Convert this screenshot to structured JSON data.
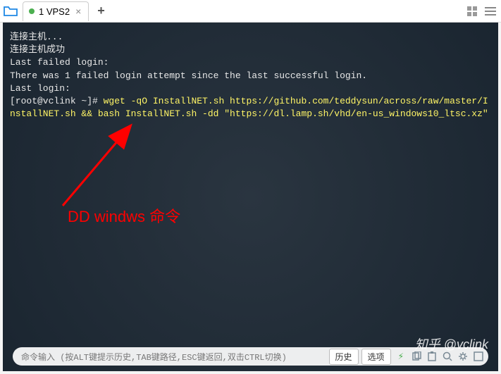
{
  "tabs": {
    "active": {
      "label": "1 VPS2"
    }
  },
  "terminal": {
    "l1": "连接主机...",
    "l2": "连接主机成功",
    "l3": "Last failed login:",
    "l4": "There was 1 failed login attempt since the last successful login.",
    "l5": "Last login:",
    "prompt": "[root@vclink ~]# ",
    "cmd": "wget -qO InstallNET.sh https://github.com/teddysun/across/raw/master/InstallNET.sh && bash InstallNET.sh -dd \"https://dl.lamp.sh/vhd/en-us_windows10_ltsc.xz\""
  },
  "annotation": {
    "text": "DD windws 命令"
  },
  "bottom": {
    "hint": "命令输入 (按ALT键提示历史,TAB键路径,ESC键返回,双击CTRL切换)",
    "history": "历史",
    "options": "选项"
  },
  "watermark": "知乎 @vclink"
}
